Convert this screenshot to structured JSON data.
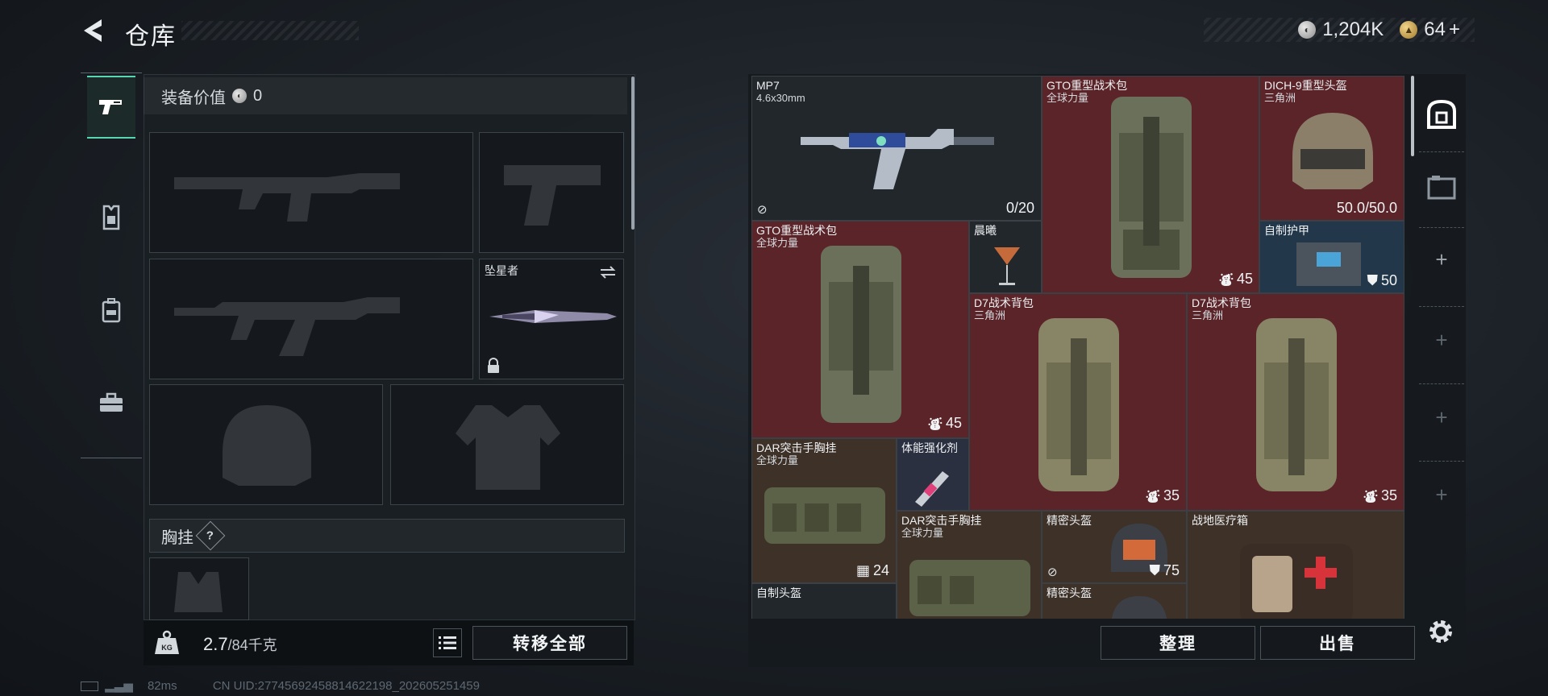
{
  "header": {
    "title": "仓库"
  },
  "currency": {
    "silver": "1,204K",
    "gold": "64",
    "gold_plus": "+"
  },
  "loadout": {
    "equip_value_label": "装备价值",
    "equip_value": "0",
    "melee_slot_name": "坠星者",
    "chest_rig_label": "胸挂",
    "chest_help": "?",
    "weight_current": "2.7",
    "weight_max": "/84千克",
    "transfer_all": "转移全部"
  },
  "status": {
    "ping": "82ms",
    "uid": "CN UID:27745692458814622198_202605251459"
  },
  "storage": {
    "items": [
      {
        "name": "MP7",
        "sub": "4.6x30mm",
        "value": "0/20"
      },
      {
        "name": "GTO重型战术包",
        "sub": "全球力量",
        "value": ""
      },
      {
        "name": "DICH-9重型头盔",
        "sub": "三角洲",
        "value": "50.0/50.0"
      },
      {
        "name": "GTO重型战术包",
        "sub": "全球力量",
        "value": "45"
      },
      {
        "name": "晨曦",
        "sub": "",
        "value": ""
      },
      {
        "name": "自制护甲",
        "sub": "",
        "value": "50"
      },
      {
        "name": "D7战术背包",
        "sub": "三角洲",
        "value": "35"
      },
      {
        "name": "D7战术背包",
        "sub": "三角洲",
        "value": "35"
      },
      {
        "name": "GTO重型战术包",
        "sub": "全球力量",
        "value": "45"
      },
      {
        "name": "DAR突击手胸挂",
        "sub": "全球力量",
        "value": "24"
      },
      {
        "name": "体能强化剂",
        "sub": "",
        "value": ""
      },
      {
        "name": "DAR突击手胸挂",
        "sub": "全球力量",
        "value": ""
      },
      {
        "name": "精密头盔",
        "sub": "",
        "value": "75"
      },
      {
        "name": "战地医疗箱",
        "sub": "",
        "value": ""
      },
      {
        "name": "自制头盔",
        "sub": "",
        "value": ""
      },
      {
        "name": "精密头盔",
        "sub": "",
        "value": ""
      }
    ],
    "sort_label": "整理",
    "sell_label": "出售"
  },
  "colors": {
    "accent": "#58d6b2",
    "rare_red": "#5a2429",
    "slot_blue": "#22384a"
  }
}
